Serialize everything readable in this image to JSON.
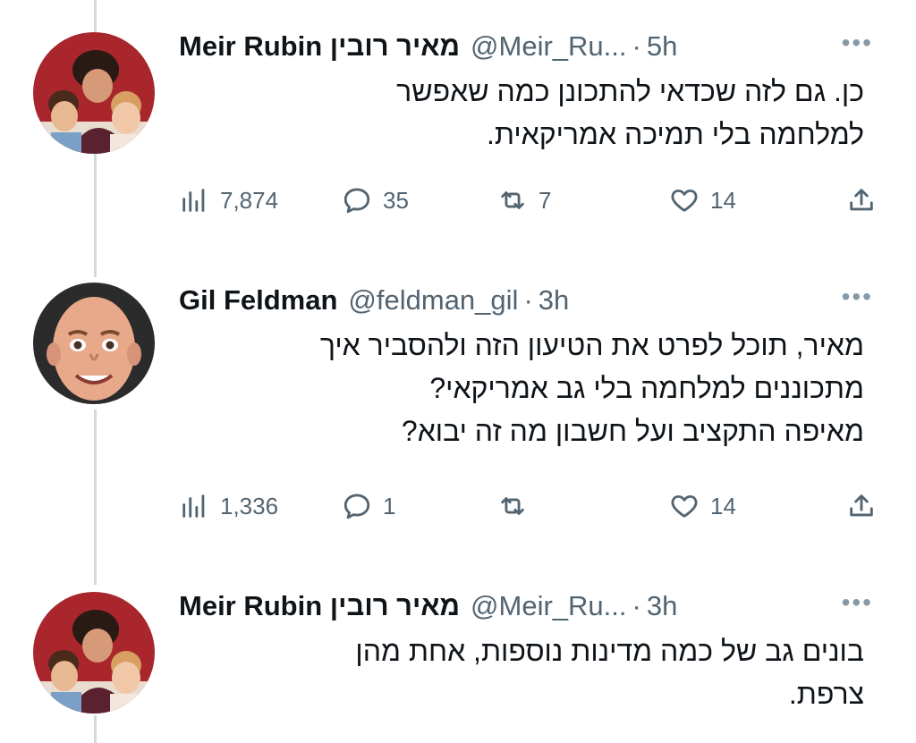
{
  "tweets": [
    {
      "name": "Meir Rubin מאיר רובין",
      "handle": "@Meir_Ru...",
      "separator": "·",
      "time": "5h",
      "more": "•••",
      "lines": [
        "כן. גם לזה שכדאי להתכונן כמה שאפשר",
        "למלחמה בלי תמיכה אמריקאית."
      ],
      "views": "7,874",
      "replies": "35",
      "retweets": "7",
      "likes": "14"
    },
    {
      "name": "Gil Feldman",
      "handle": "@feldman_gil",
      "separator": "·",
      "time": "3h",
      "more": "•••",
      "lines": [
        "מאיר, תוכל לפרט את הטיעון הזה ולהסביר איך",
        "מתכוננים למלחמה בלי גב אמריקאי?",
        "מאיפה התקציב ועל חשבון מה זה יבוא?"
      ],
      "views": "1,336",
      "replies": "1",
      "retweets": "",
      "likes": "14"
    },
    {
      "name": "Meir Rubin מאיר רובין",
      "handle": "@Meir_Ru...",
      "separator": "·",
      "time": "3h",
      "more": "•••",
      "lines": [
        "בונים גב של כמה מדינות נוספות, אחת מהן",
        "צרפת."
      ]
    }
  ],
  "icons": {
    "views": "bar-chart-icon",
    "reply": "speech-bubble-icon",
    "retweet": "retweet-arrows-icon",
    "like": "heart-icon",
    "share": "share-upload-icon",
    "more": "more-dots-icon"
  },
  "colors": {
    "text": "#0f1419",
    "secondary": "#536471",
    "thread_line": "#cfd9de"
  }
}
